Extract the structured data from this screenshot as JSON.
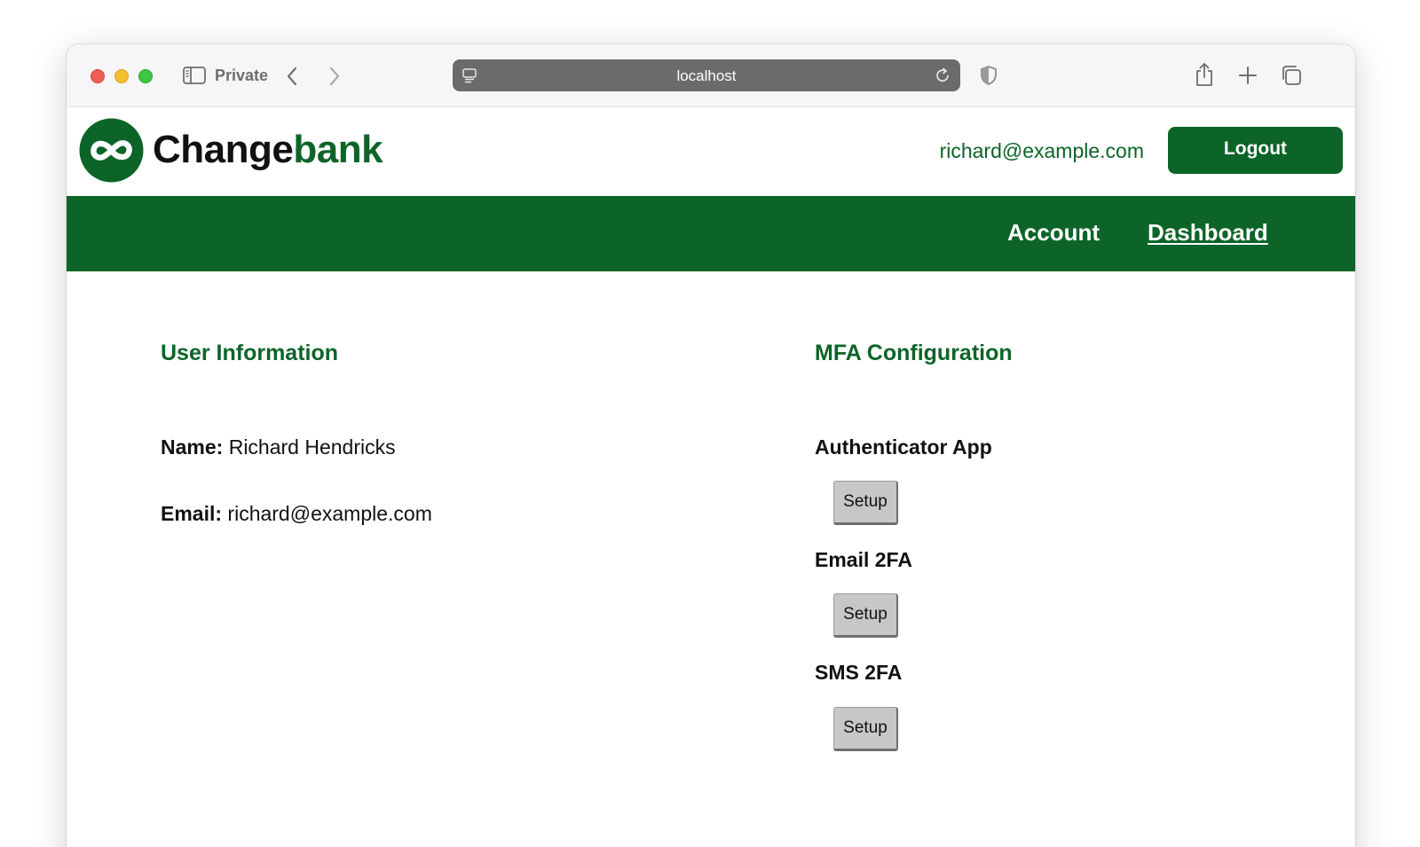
{
  "browser": {
    "private_label": "Private",
    "url": "localhost"
  },
  "header": {
    "brand_part1": "Change",
    "brand_part2": "bank",
    "user_email": "richard@example.com",
    "logout_label": "Logout"
  },
  "nav": {
    "items": [
      {
        "label": "Account"
      },
      {
        "label": "Dashboard"
      }
    ]
  },
  "user_info": {
    "title": "User Information",
    "name_label": "Name:",
    "name_value": "Richard Hendricks",
    "email_label": "Email:",
    "email_value": "richard@example.com"
  },
  "mfa": {
    "title": "MFA Configuration",
    "methods": [
      {
        "label": "Authenticator App",
        "button": "Setup"
      },
      {
        "label": "Email 2FA",
        "button": "Setup"
      },
      {
        "label": "SMS 2FA",
        "button": "Setup"
      }
    ]
  },
  "colors": {
    "brand_green": "#0c6428",
    "setup_button_bg": "#c7c7c7",
    "address_bar": "#6b6b6b"
  },
  "icons": [
    "sidebar-toggle-icon",
    "back-icon",
    "forward-icon",
    "page-menu-icon",
    "reload-icon",
    "shield-icon",
    "share-icon",
    "new-tab-icon",
    "tabs-overview-icon",
    "logo-icon"
  ]
}
